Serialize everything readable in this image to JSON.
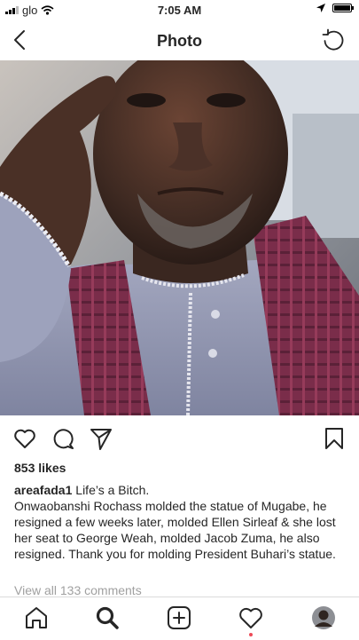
{
  "status": {
    "carrier": "glo",
    "time": "7:05 AM"
  },
  "nav": {
    "title": "Photo"
  },
  "post": {
    "likes": "853 likes",
    "username": "areafada1",
    "caption_lead": "Life’s a Bitch.",
    "caption_body": "Onwaobanshi Rochass molded the statue of Mugabe, he resigned a few weeks later, molded Ellen Sirleaf & she lost her seat to George Weah, molded Jacob Zuma, he also resigned. Thank you for molding President Buhari’s statue.",
    "view_comments": "View all 133 comments"
  },
  "icons": {
    "back": "chevron-left-icon",
    "refresh": "refresh-icon",
    "like": "heart-icon",
    "comment": "comment-icon",
    "share": "send-icon",
    "save": "bookmark-icon",
    "home": "home-icon",
    "search": "search-icon",
    "add": "add-icon",
    "activity": "heart-icon",
    "profile": "avatar"
  },
  "colors": {
    "text": "#262626",
    "muted": "#a0a0a0",
    "notification": "#ed4956",
    "divider": "#dbdbdb"
  }
}
